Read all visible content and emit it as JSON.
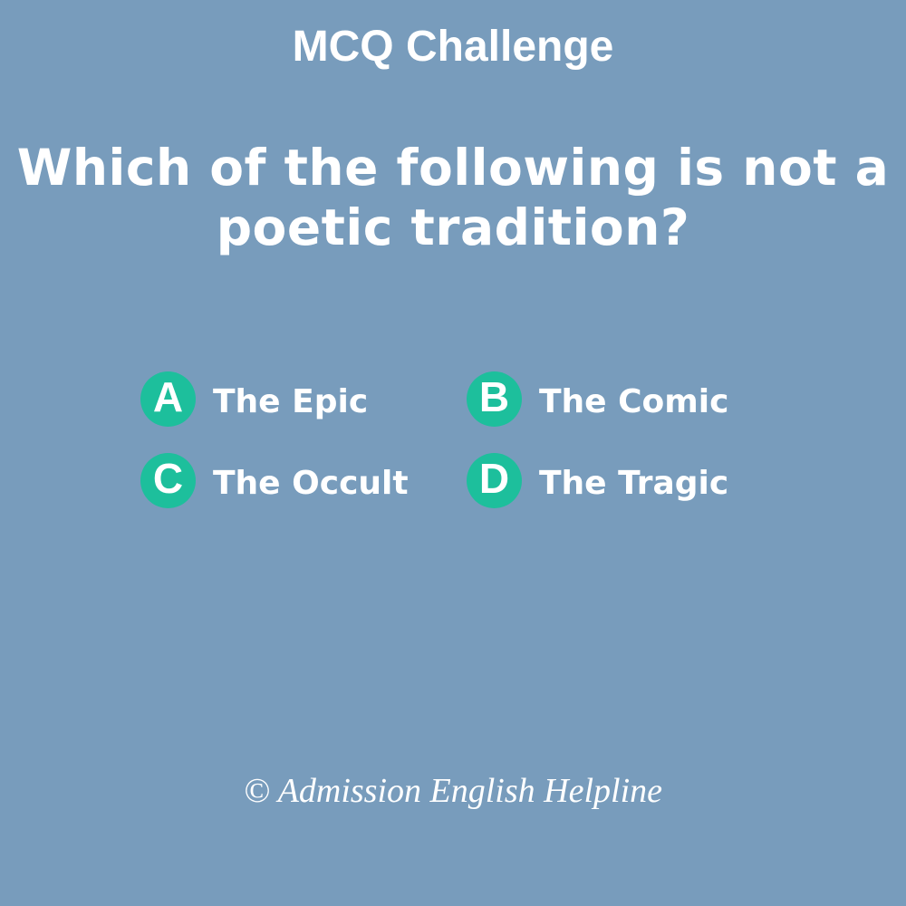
{
  "heading": "MCQ Challenge",
  "question": {
    "line1": "Which of the following is not a",
    "line2": "poetic tradition?"
  },
  "options": [
    {
      "letter": "A",
      "text": "The Epic"
    },
    {
      "letter": "B",
      "text": "The Comic"
    },
    {
      "letter": "C",
      "text": "The Occult"
    },
    {
      "letter": "D",
      "text": "The Tragic"
    }
  ],
  "footer": "© Admission English Helpline",
  "colors": {
    "background": "#789cbc",
    "badge": "#1dbf9c",
    "text": "#ffffff"
  }
}
